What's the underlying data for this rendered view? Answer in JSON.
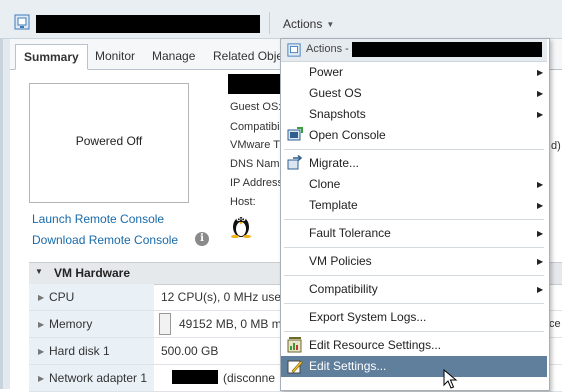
{
  "top_bar": {
    "actions_label": "Actions"
  },
  "tabs": [
    {
      "label": "Summary"
    },
    {
      "label": "Monitor"
    },
    {
      "label": "Manage"
    },
    {
      "label": "Related Obje"
    }
  ],
  "summary": {
    "power_state": "Powered Off",
    "fields": [
      {
        "label": "Guest OS:"
      },
      {
        "label": "Compatibili"
      },
      {
        "label": "VMware T"
      },
      {
        "label": "DNS Name"
      },
      {
        "label": "IP Address"
      },
      {
        "label": "Host:"
      }
    ],
    "launch_console": "Launch Remote Console",
    "download_console": "Download Remote Console",
    "right_edge_d": "d)",
    "right_edge_ce": "ce"
  },
  "vm_hardware": {
    "title": "VM Hardware",
    "rows": [
      {
        "label": "CPU",
        "value": "12 CPU(s), 0 MHz use"
      },
      {
        "label": "Memory",
        "value": "49152 MB, 0 MB m"
      },
      {
        "label": "Hard disk 1",
        "value": "500.00 GB"
      },
      {
        "label": "Network adapter 1",
        "value": "(disconne"
      }
    ]
  },
  "menu": {
    "header_label": "Actions -",
    "items": [
      {
        "label": "Power",
        "submenu": true
      },
      {
        "label": "Guest OS",
        "submenu": true
      },
      {
        "label": "Snapshots",
        "submenu": true
      },
      {
        "label": "Open Console",
        "submenu": false,
        "icon": "console-icon"
      },
      {
        "label": "Migrate...",
        "submenu": false,
        "icon": "migrate-icon"
      },
      {
        "label": "Clone",
        "submenu": true
      },
      {
        "label": "Template",
        "submenu": true
      },
      {
        "label": "Fault Tolerance",
        "submenu": true
      },
      {
        "label": "VM Policies",
        "submenu": true
      },
      {
        "label": "Compatibility",
        "submenu": true
      },
      {
        "label": "Export System Logs...",
        "submenu": false
      },
      {
        "label": "Edit Resource Settings...",
        "submenu": false,
        "icon": "resource-settings-icon"
      },
      {
        "label": "Edit Settings...",
        "submenu": false,
        "icon": "edit-settings-icon",
        "highlighted": true
      }
    ]
  },
  "colors": {
    "link": "#1a6aa8",
    "highlight": "#5f7f9c",
    "top_bar": "#e9eef3"
  }
}
